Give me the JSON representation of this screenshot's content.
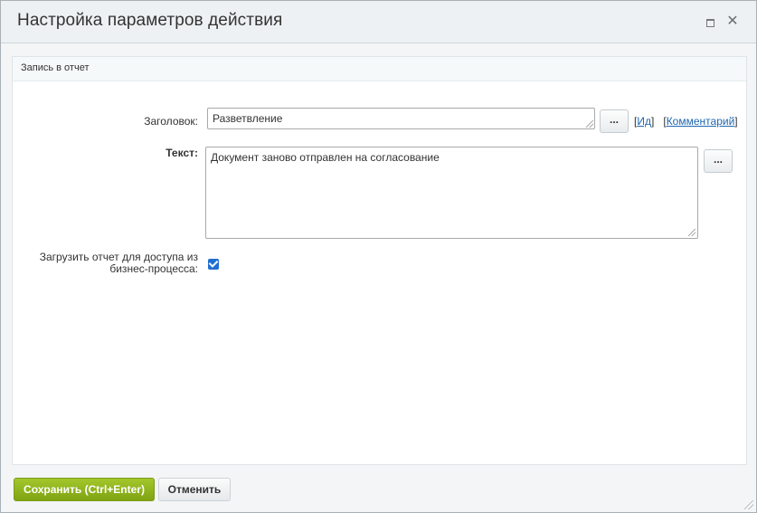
{
  "dialog": {
    "title": "Настройка параметров действия",
    "maximize_icon": "maximize-icon",
    "close_glyph": "✕"
  },
  "section": {
    "title": "Запись в отчет"
  },
  "form": {
    "header_label": "Заголовок:",
    "header_value": "Разветвление",
    "header_dots": "...",
    "link_id": "Ид",
    "link_comment": "Комментарий",
    "link_open": "[",
    "link_close": "]",
    "text_label": "Текст:",
    "text_value": "Документ заново отправлен на согласование",
    "text_dots": "...",
    "upload_label": "Загрузить отчет для доступа из бизнес-процесса:",
    "upload_checked": true
  },
  "footer": {
    "save_label": "Сохранить (Ctrl+Enter)",
    "cancel_label": "Отменить"
  },
  "colors": {
    "save_button": "#8db31d",
    "link": "#2067b0",
    "checkbox": "#1f6fd1"
  }
}
